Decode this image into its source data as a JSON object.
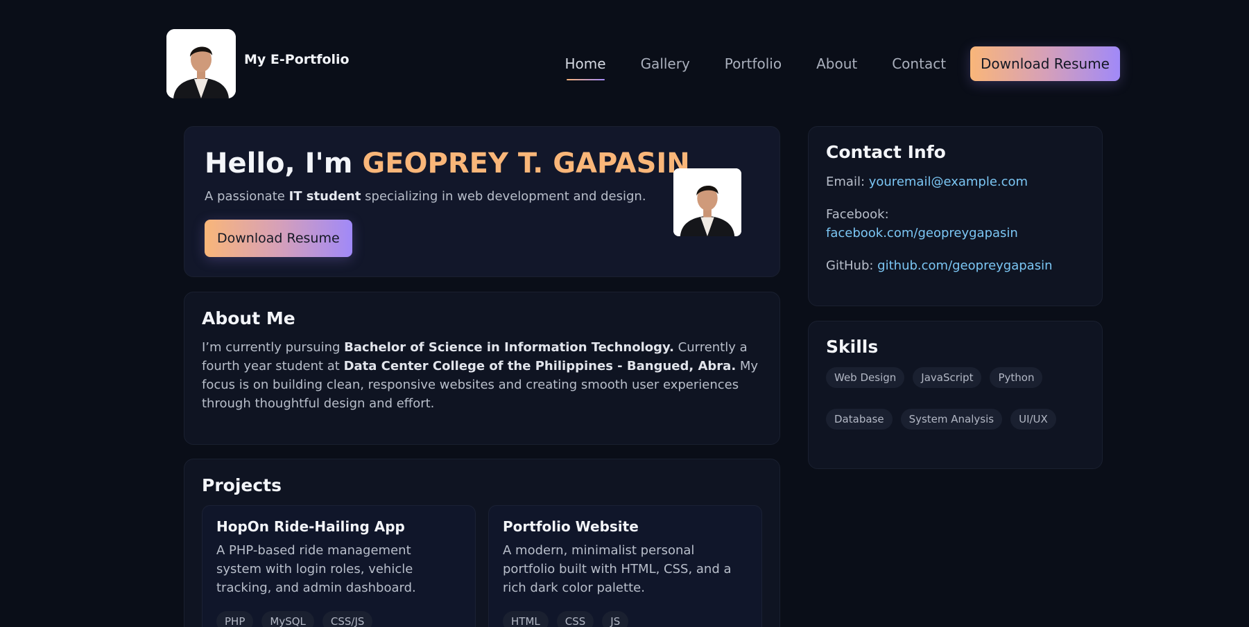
{
  "header": {
    "brand": "My E-Portfolio",
    "nav": [
      "Home",
      "Gallery",
      "Portfolio",
      "About",
      "Contact"
    ],
    "active": "Home",
    "cta": "Download Resume"
  },
  "hero": {
    "greeting": "Hello, I'm ",
    "name": "GEOPREY T. GAPASIN",
    "tagline_pre": "A passionate ",
    "tagline_bold": "IT student",
    "tagline_post": " specializing in web development and design.",
    "cta": "Download Resume"
  },
  "about": {
    "title": "About Me",
    "t1": "I’m currently pursuing ",
    "b1": "Bachelor of Science in Information Technology.",
    "t2": " Currently a fourth year student at ",
    "b2": "Data Center College of the Philippines - Bangued, Abra.",
    "t3": " My focus is on building clean, responsive websites and creating smooth user experiences through thoughtful design and effort."
  },
  "projects": {
    "title": "Projects",
    "items": [
      {
        "title": "HopOn Ride-Hailing App",
        "desc": "A PHP-based ride management system with login roles, vehicle tracking, and admin dashboard.",
        "tags": [
          "PHP",
          "MySQL",
          "CSS/JS"
        ]
      },
      {
        "title": "Portfolio Website",
        "desc": "A modern, minimalist personal portfolio built with HTML, CSS, and a rich dark color palette.",
        "tags": [
          "HTML",
          "CSS",
          "JS"
        ]
      }
    ]
  },
  "contact": {
    "title": "Contact Info",
    "email_label": "Email: ",
    "email": "youremail@example.com",
    "facebook_label": "Facebook:",
    "facebook": "facebook.com/geopreygapasin",
    "github_label": "GitHub: ",
    "github": "github.com/geopreygapasin"
  },
  "skills": {
    "title": "Skills",
    "items": [
      "Web Design",
      "JavaScript",
      "Python",
      "Database",
      "System Analysis",
      "UI/UX"
    ]
  },
  "colors": {
    "background": "#0a0e18",
    "accent_orange": "#f9b679",
    "accent_purple": "#a089f8",
    "link": "#7cc7f5"
  }
}
